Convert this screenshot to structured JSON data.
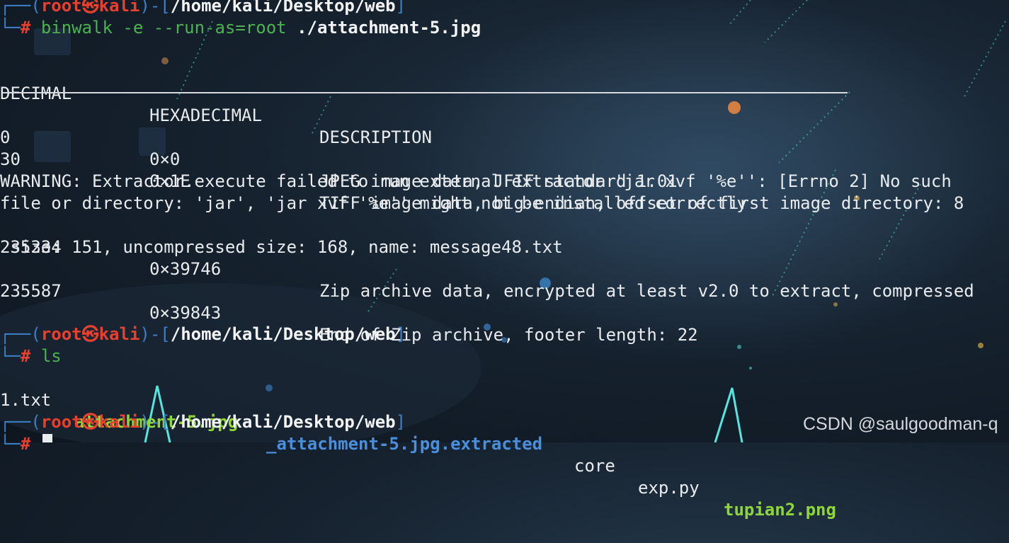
{
  "prompt_user": "root",
  "prompt_skull": "㉿",
  "prompt_host": "kali",
  "cwd": "/home/kali/Desktop/web",
  "prompt_corner_top": "┌──(",
  "prompt_corner_close": ")-[",
  "prompt_bracket_end": "]",
  "prompt_corner_bottom": "└─",
  "prompt_hash": "#",
  "command1": {
    "name": "binwalk",
    "args": " -e --run-as=root ",
    "file": "./attachment-5.jpg"
  },
  "binwalk": {
    "headers": [
      "DECIMAL",
      "HEXADECIMAL",
      "DESCRIPTION"
    ],
    "rows": [
      {
        "decimal": "0",
        "hex": "0×0",
        "description": "JPEG image data, JFIF standard 1.01"
      },
      {
        "decimal": "30",
        "hex": "0×1E",
        "description": "TIFF image data, big-endian, offset of first image directory: 8"
      }
    ],
    "warning_line1": "WARNING: Extractor.execute failed to run external extractor 'jar xvf '%e'': [Errno 2] No such",
    "warning_line2": "file or directory: 'jar', 'jar xvf '%e'' might not be installed correctly",
    "zip_row": {
      "decimal": "235334",
      "hex": "0×39746",
      "description": "Zip archive data, encrypted at least v2.0 to extract, compressed",
      "continuation": " size: 151, uncompressed size: 168, name: message48.txt"
    },
    "end_row": {
      "decimal": "235587",
      "hex": "0×39843",
      "description": "End of Zip archive, footer length: 22"
    }
  },
  "command2": "ls",
  "ls_output": [
    {
      "name": "1.txt",
      "kind": "file"
    },
    {
      "name": "attachment-5.jpg",
      "kind": "image"
    },
    {
      "name": "_attachment-5.jpg.extracted",
      "kind": "directory"
    },
    {
      "name": "core",
      "kind": "file"
    },
    {
      "name": "exp.py",
      "kind": "file"
    },
    {
      "name": "tupian2.png",
      "kind": "image"
    }
  ],
  "watermark": "CSDN @saulgoodman-q",
  "colors": {
    "prompt_red": "#e8402f",
    "frame_blue": "#3d7fc8",
    "command_green": "#4bb352",
    "image_file_green": "#8fd63a",
    "directory_blue": "#4a8fdc",
    "text": "#e9ecef"
  }
}
